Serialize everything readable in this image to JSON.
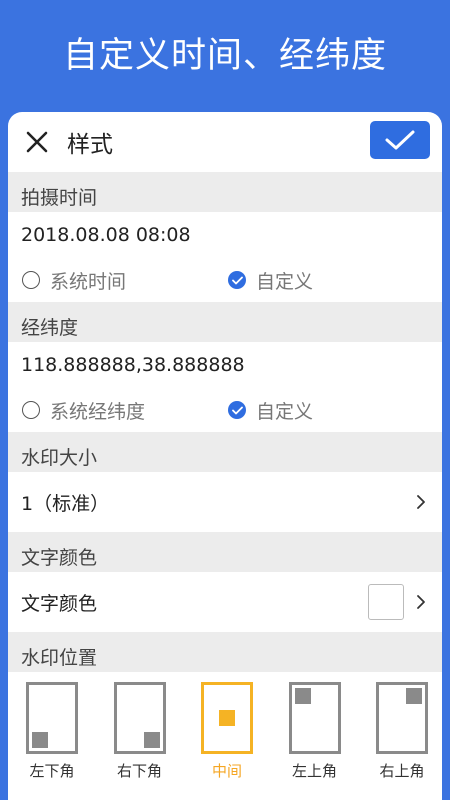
{
  "banner": {
    "title": "自定义时间、经纬度"
  },
  "topbar": {
    "title": "样式"
  },
  "time_section": {
    "header": "拍摄时间",
    "value": "2018.08.08 08:08",
    "option_system": "系统时间",
    "option_custom": "自定义",
    "selected": "custom"
  },
  "location_section": {
    "header": "经纬度",
    "value": "118.888888,38.888888",
    "option_system": "系统经纬度",
    "option_custom": "自定义",
    "selected": "custom"
  },
  "size_section": {
    "header": "水印大小",
    "value": "1（标准）"
  },
  "color_section": {
    "header": "文字颜色",
    "label": "文字颜色",
    "swatch_color": "#ffffff"
  },
  "position_section": {
    "header": "水印位置",
    "options": [
      {
        "label": "左下角",
        "active": false
      },
      {
        "label": "右下角",
        "active": false
      },
      {
        "label": "中间",
        "active": true
      },
      {
        "label": "左上角",
        "active": false
      },
      {
        "label": "右上角",
        "active": false
      }
    ]
  },
  "colors": {
    "brand_blue": "#3b73e0",
    "confirm_blue": "#2f6de0",
    "active_orange": "#f5b324"
  }
}
